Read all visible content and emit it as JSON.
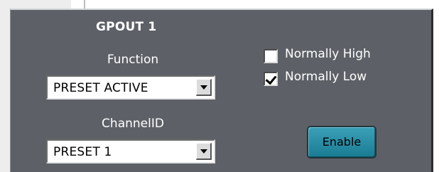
{
  "panel": {
    "title": "GPOUT 1",
    "function_label": "Function",
    "function_value": "PRESET ACTIVE",
    "channel_label": "ChannelID",
    "channel_value": "PRESET 1",
    "checkbox_high_label": "Normally High",
    "checkbox_high_checked": false,
    "checkbox_low_label": "Normally Low",
    "checkbox_low_checked": true,
    "enable_label": "Enable"
  },
  "colors": {
    "panel_bg": "#5d6167",
    "enable_button": "#2a90a8"
  },
  "icons": {
    "dropdown": "chevron-down-icon",
    "check": "check-icon"
  }
}
